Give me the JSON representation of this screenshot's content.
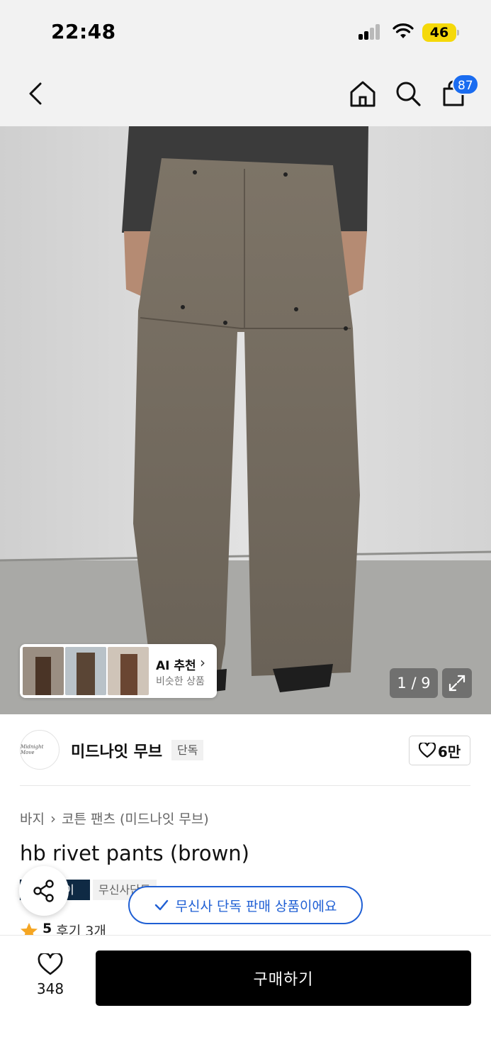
{
  "status_bar": {
    "time": "22:48",
    "battery": "46",
    "icons": [
      "signal-icon",
      "wifi-icon",
      "battery-icon"
    ]
  },
  "nav": {
    "cart_count": "87",
    "icons": [
      "back-icon",
      "home-icon",
      "search-icon",
      "cart-icon"
    ]
  },
  "hero": {
    "ai_title": "AI 추천",
    "ai_subtitle": "비슷한 상품",
    "pager": "1 / 9"
  },
  "brand": {
    "logo_text": "Midnight Move",
    "name": "미드나잇 무브",
    "exclusive_tag": "단독",
    "likes": "6만"
  },
  "product": {
    "breadcrumb": [
      "바지",
      "코튼 팬츠 (미드나잇 무브)"
    ],
    "title": "hb rivet pants (brown)",
    "tags": [
      "이",
      "무신사단독"
    ],
    "rating": "5",
    "review_count": "후기 3개"
  },
  "toast": {
    "text": "무신사 단독 판매 상품이에요"
  },
  "bottom_bar": {
    "wish_count": "348",
    "buy_label": "구매하기"
  },
  "colors": {
    "accent_blue": "#1f5fd4",
    "badge_blue": "#1a6cf0",
    "battery_yellow": "#f5d90a",
    "star_orange": "#f5a623",
    "buy_black": "#000000"
  }
}
